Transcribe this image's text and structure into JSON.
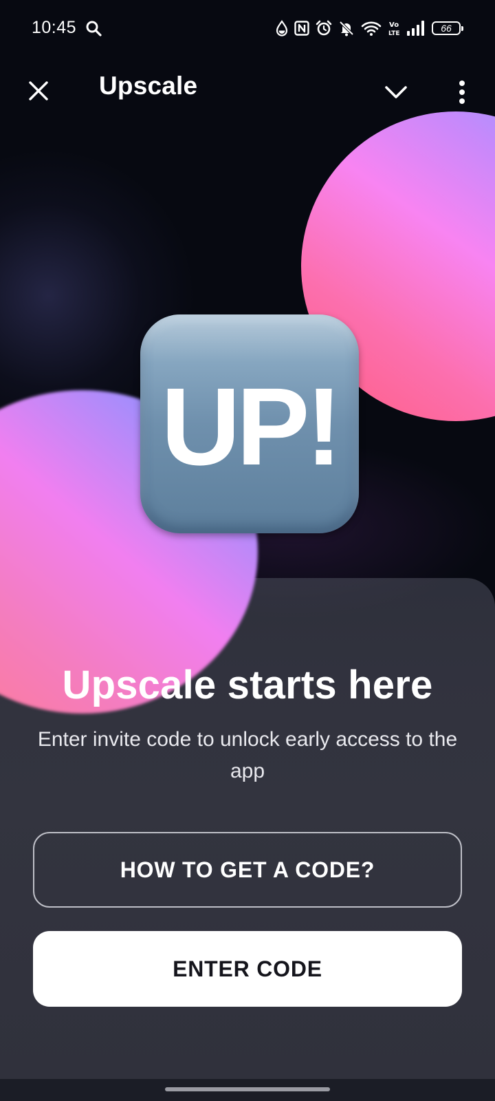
{
  "status_bar": {
    "time": "10:45",
    "battery_level": "66",
    "icons": [
      "search-icon",
      "data-saver-icon",
      "nfc-icon",
      "alarm-icon",
      "mute-icon",
      "wifi-icon",
      "volte-icon",
      "signal-icon",
      "battery-icon"
    ]
  },
  "app_bar": {
    "title": "Upscale",
    "close_icon": "close-icon",
    "collapse_icon": "chevron-down-icon",
    "menu_icon": "more-vertical-icon"
  },
  "logo": {
    "text": "UP!"
  },
  "sheet": {
    "headline": "Upscale starts here",
    "subtitle": "Enter invite code to unlock early access to the app",
    "secondary_button": "HOW TO GET A CODE?",
    "primary_button": "ENTER CODE"
  },
  "colors": {
    "background": "#070911",
    "sheet": "#33343f",
    "primary_button_bg": "#ffffff",
    "primary_button_text": "#15151c",
    "logo_tile": "#6f90ad",
    "orb_pink": "#f884f2",
    "orb_blue": "#8d9dff"
  }
}
